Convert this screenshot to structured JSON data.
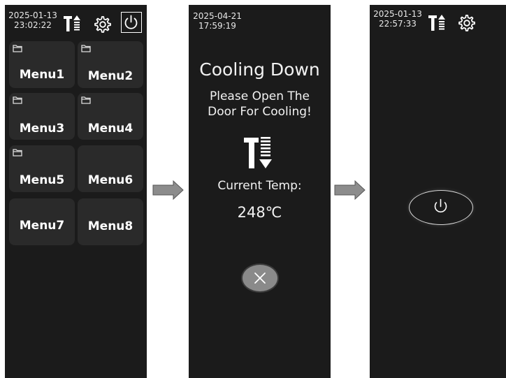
{
  "screen1": {
    "date": "2025-01-13",
    "time": "23:02:22",
    "icons": [
      "temperature-up-icon",
      "gear-icon",
      "power-icon"
    ],
    "menus": [
      {
        "label": "Menu1",
        "has_folder": true
      },
      {
        "label": "Menu2",
        "has_folder": true
      },
      {
        "label": "Menu3",
        "has_folder": true
      },
      {
        "label": "Menu4",
        "has_folder": true
      },
      {
        "label": "Menu5",
        "has_folder": true
      },
      {
        "label": "Menu6",
        "has_folder": false
      },
      {
        "label": "Menu7",
        "has_folder": false
      },
      {
        "label": "Menu8",
        "has_folder": false
      }
    ]
  },
  "screen2": {
    "date": "2025-04-21",
    "time": "17:59:19",
    "title": "Cooling Down",
    "message_line1": "Please Open The",
    "message_line2": "Door For Cooling!",
    "icon": "temperature-down-icon",
    "current_temp_label": "Current Temp:",
    "current_temp_value": "248℃",
    "close_icon": "close-icon"
  },
  "screen3": {
    "date": "2025-01-13",
    "time": "22:57:33",
    "icons": [
      "temperature-up-icon",
      "gear-icon"
    ],
    "power_icon": "power-icon"
  },
  "arrows": [
    "arrow-right-icon",
    "arrow-right-icon"
  ],
  "colors": {
    "panel_bg": "#1b1b1b",
    "tile_bg": "#2a2a2a",
    "arrow_fill": "#8c8c8c",
    "close_button": "#8a8a8a"
  }
}
